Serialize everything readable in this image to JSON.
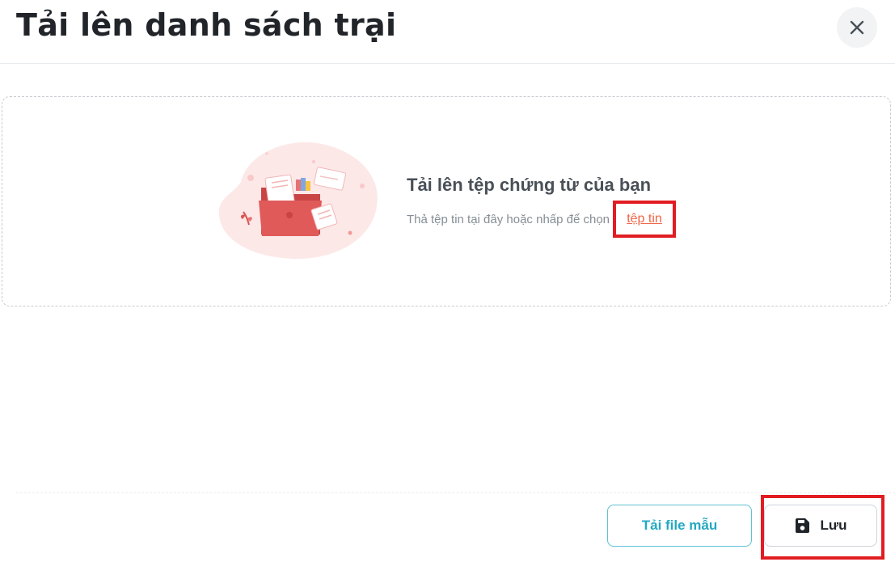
{
  "dialog": {
    "title": "Tải lên danh sách trại",
    "close_icon": "close-icon"
  },
  "dropzone": {
    "title": "Tải lên tệp chứng từ của bạn",
    "hint": "Thả tệp tin tại đây hoặc nhấp để chọn",
    "link_label": "tệp tin",
    "illustration_icon": "folder-upload-illustration"
  },
  "footer": {
    "template_button_label": "Tải file mẫu",
    "save_button_label": "Lưu",
    "save_icon": "floppy-disk-icon"
  },
  "colors": {
    "accent_link": "#f06548",
    "template_button": "#24a8c2",
    "highlight": "#e11d22"
  }
}
